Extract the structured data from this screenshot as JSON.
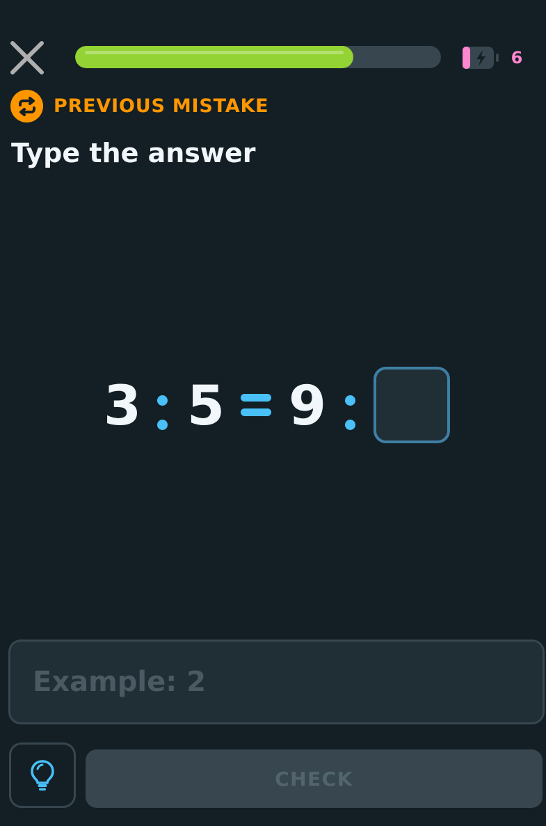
{
  "header": {
    "close_icon": "close-icon",
    "progress": 0.76,
    "energy_icon": "battery-bolt-icon",
    "energy_count": "6",
    "colors": {
      "progress_fill": "#93d333",
      "progress_track": "#37464f",
      "energy": "#ff86d0"
    }
  },
  "badge": {
    "icon": "repeat-icon",
    "label": "PREVIOUS MISTAKE",
    "color": "#ff9600"
  },
  "prompt": {
    "title": "Type the answer"
  },
  "equation": {
    "a": "3",
    "b": "5",
    "c": "9",
    "operator_color": "#49c0f8"
  },
  "input": {
    "value": "",
    "placeholder": "Example: 2"
  },
  "footer": {
    "hint_icon": "lightbulb-icon",
    "check_label": "CHECK"
  }
}
